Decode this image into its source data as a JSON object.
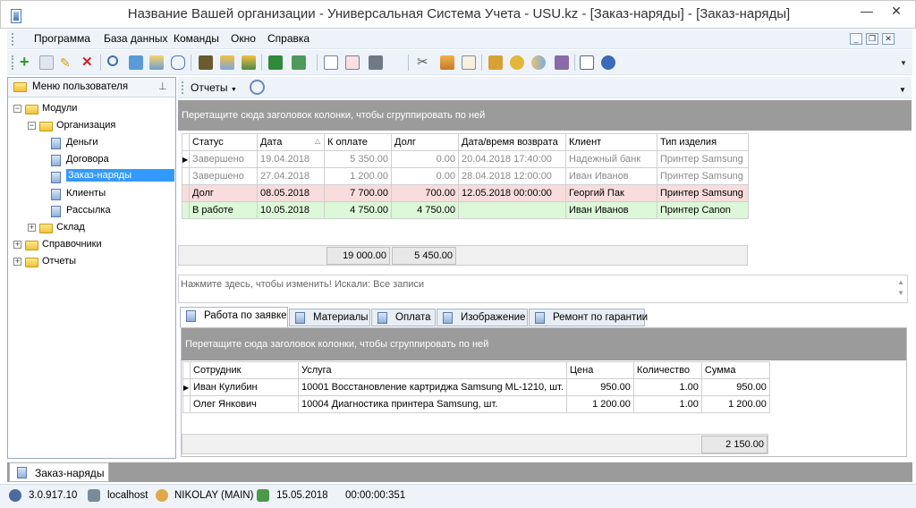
{
  "window": {
    "title": "Название Вашей организации - Универсальная Система Учета - USU.kz - [Заказ-наряды] - [Заказ-наряды]",
    "minimize": "—",
    "close": "✕"
  },
  "menu": {
    "items": [
      "Программа",
      "База данных",
      "Команды",
      "Окно",
      "Справка"
    ],
    "mdi_minimize": "_",
    "mdi_restore": "❐",
    "mdi_close": "✕"
  },
  "toolbar": {
    "icons": [
      "add-icon",
      "copy-icon",
      "edit-icon",
      "delete-icon",
      "search-icon",
      "refresh-icon",
      "sort-icon",
      "comment-icon",
      "binoculars-icon",
      "filter-icon",
      "filter-clear-icon",
      "export-excel-icon",
      "export-icon",
      "new-window-icon",
      "close-window-icon",
      "print-icon",
      "tools-icon",
      "paint-icon",
      "form-icon",
      "lock-icon",
      "key-icon",
      "users-icon",
      "settings-icon",
      "book-icon",
      "info-icon"
    ]
  },
  "left_panel": {
    "header": "Меню пользователя",
    "tree": [
      {
        "label": "Модули",
        "level": 0,
        "type": "folder",
        "expander": "−"
      },
      {
        "label": "Организация",
        "level": 1,
        "type": "folder",
        "expander": "−"
      },
      {
        "label": "Деньги",
        "level": 2,
        "type": "doc"
      },
      {
        "label": "Договора",
        "level": 2,
        "type": "doc"
      },
      {
        "label": "Заказ-наряды",
        "level": 2,
        "type": "doc",
        "selected": true
      },
      {
        "label": "Клиенты",
        "level": 2,
        "type": "doc"
      },
      {
        "label": "Рассылка",
        "level": 2,
        "type": "doc"
      },
      {
        "label": "Склад",
        "level": 1,
        "type": "folder",
        "expander": "+"
      },
      {
        "label": "Справочники",
        "level": 0,
        "type": "folder",
        "expander": "+"
      },
      {
        "label": "Отчеты",
        "level": 0,
        "type": "folder",
        "expander": "+"
      }
    ]
  },
  "reports": {
    "label": "Отчеты"
  },
  "main_grid": {
    "group_hint": "Перетащите сюда заголовок колонки, чтобы сгруппировать по ней",
    "columns": [
      "Статус",
      "Дата",
      "К оплате",
      "Долг",
      "Дата/время возврата",
      "Клиент",
      "Тип изделия"
    ],
    "rows": [
      {
        "style": "gray",
        "cells": [
          "Завершено",
          "19.04.2018",
          "5 350.00",
          "0.00",
          "20.04.2018 17:40:00",
          "Надежный банк",
          "Принтер Samsung"
        ]
      },
      {
        "style": "gray",
        "cells": [
          "Завершено",
          "27.04.2018",
          "1 200.00",
          "0.00",
          "28.04.2018 12:00:00",
          "Иван Иванов",
          "Принтер Samsung"
        ]
      },
      {
        "style": "pink",
        "cells": [
          "Долг",
          "08.05.2018",
          "7 700.00",
          "700.00",
          "12.05.2018 00:00:00",
          "Георгий Пак",
          "Принтер Samsung"
        ]
      },
      {
        "style": "green",
        "cells": [
          "В работе",
          "10.05.2018",
          "4 750.00",
          "4 750.00",
          "",
          "Иван Иванов",
          "Принтер Canon"
        ]
      }
    ],
    "totals": {
      "to_pay": "19 000.00",
      "debt": "5 450.00"
    }
  },
  "filter_bar": {
    "text": "Нажмите здесь, чтобы изменить! Искали: Все записи"
  },
  "detail_tabs": [
    "Работа по заявке",
    "Материалы",
    "Оплата",
    "Изображение",
    "Ремонт по гарантии"
  ],
  "detail_grid": {
    "group_hint": "Перетащите сюда заголовок колонки, чтобы сгруппировать по ней",
    "columns": [
      "Сотрудник",
      "Услуга",
      "Цена",
      "Количество",
      "Сумма"
    ],
    "rows": [
      [
        "Иван Кулибин",
        "10001 Восстановление картриджа Samsung ML-1210, шт.",
        "950.00",
        "1.00",
        "950.00"
      ],
      [
        "Олег Янкович",
        "10004 Диагностика принтера Samsung, шт.",
        "1 200.00",
        "1.00",
        "1 200.00"
      ]
    ],
    "total": "2 150.00"
  },
  "doc_tab": {
    "label": "Заказ-наряды"
  },
  "status": {
    "version": "3.0.917.10",
    "host": "localhost",
    "user": "NIKOLAY (MAIN)",
    "date": "15.05.2018",
    "timer": "00:00:00:351"
  },
  "colors": {
    "row_debt": "#f9dcdc",
    "row_in_work": "#dcf8d8",
    "selection": "#3399ff",
    "group_bar": "#9b9b9b"
  }
}
